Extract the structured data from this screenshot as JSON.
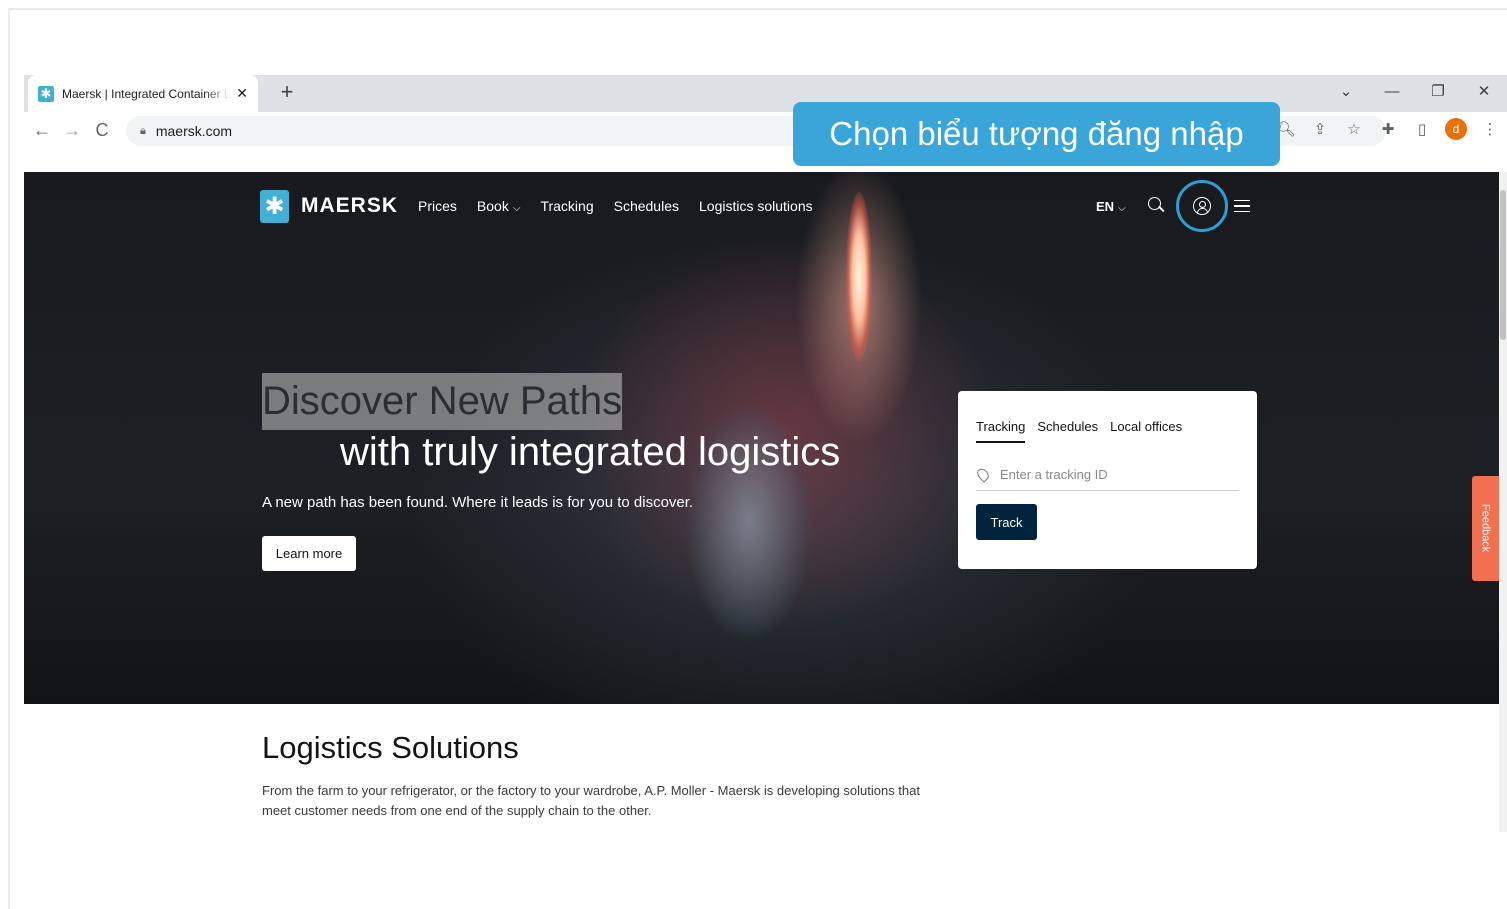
{
  "browser": {
    "tab_title": "Maersk | Integrated Container Lo",
    "tab_close": "✕",
    "new_tab": "+",
    "url": "maersk.com",
    "win_controls": [
      "⌄",
      "—",
      "❐",
      "✕"
    ],
    "avatar_letter": "d"
  },
  "site": {
    "logo_text": "MAERSK",
    "nav": {
      "prices": "Prices",
      "book": "Book",
      "tracking": "Tracking",
      "schedules": "Schedules",
      "logistics": "Logistics solutions"
    },
    "lang": "EN"
  },
  "hero": {
    "title_line1": "Discover New Paths",
    "title_line2": "with truly integrated logistics",
    "subtitle": "A new path has been found. Where it leads is for you to discover.",
    "learn_more": "Learn more"
  },
  "tracking_card": {
    "tabs": [
      "Tracking",
      "Schedules",
      "Local offices"
    ],
    "placeholder": "Enter a tracking ID",
    "button": "Track"
  },
  "feedback": "Feedback",
  "section": {
    "title": "Logistics Solutions",
    "body": "From the farm to your refrigerator, or the factory to your wardrobe, A.P. Moller - Maersk is developing solutions that meet customer needs from one end of the supply chain to the other."
  },
  "callout": "Chọn biểu tượng đăng nhập",
  "colors": {
    "brand": "#42b0d5",
    "callout": "#3aa5d8",
    "track_button": "#00243d",
    "feedback": "#f26f52"
  }
}
